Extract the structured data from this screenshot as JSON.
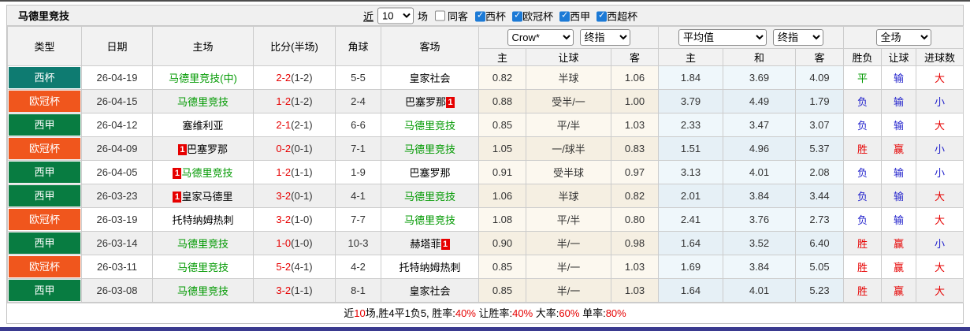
{
  "title": "马德里竞技",
  "controls": {
    "recent_label": "近",
    "recent_value": "10",
    "games_suffix": "场",
    "same_away_label": "同客",
    "league_filters": [
      {
        "label": "西杯",
        "checked": true
      },
      {
        "label": "欧冠杯",
        "checked": true
      },
      {
        "label": "西甲",
        "checked": true
      },
      {
        "label": "西超杯",
        "checked": true
      }
    ]
  },
  "selectors": {
    "company": "Crow*",
    "company_stage": "终指",
    "average": "平均值",
    "average_stage": "终指",
    "scope": "全场"
  },
  "table": {
    "headers": {
      "type": "类型",
      "date": "日期",
      "home": "主场",
      "score": "比分(半场)",
      "corner": "角球",
      "away": "客场",
      "sub": [
        "主",
        "让球",
        "客",
        "主",
        "和",
        "客",
        "胜负",
        "让球",
        "进球数"
      ]
    },
    "league_colors": {
      "西杯": "#0e7b71",
      "欧冠杯": "#f0561d",
      "西甲": "#087c41"
    },
    "rows": [
      {
        "league": "西杯",
        "date": "26-04-19",
        "home": "马德里竞技(中)",
        "home_green": true,
        "home_card": "",
        "score_ft": "2-2",
        "score_ht": "(1-2)",
        "corners": "5-5",
        "away": "皇家社会",
        "away_green": false,
        "away_card": "",
        "odds": [
          "0.82",
          "半球",
          "1.06"
        ],
        "avg": [
          "1.84",
          "3.69",
          "4.09"
        ],
        "results": [
          {
            "text": "平",
            "color": "#009900"
          },
          {
            "text": "输",
            "color": "#2222cc"
          },
          {
            "text": "大",
            "color": "#e60000"
          }
        ]
      },
      {
        "league": "欧冠杯",
        "date": "26-04-15",
        "home": "马德里竞技",
        "home_green": true,
        "home_card": "",
        "score_ft": "1-2",
        "score_ht": "(1-2)",
        "corners": "2-4",
        "away": "巴塞罗那",
        "away_green": false,
        "away_card": "1",
        "odds": [
          "0.88",
          "受半/一",
          "1.00"
        ],
        "avg": [
          "3.79",
          "4.49",
          "1.79"
        ],
        "results": [
          {
            "text": "负",
            "color": "#2222cc"
          },
          {
            "text": "输",
            "color": "#2222cc"
          },
          {
            "text": "小",
            "color": "#2222cc"
          }
        ]
      },
      {
        "league": "西甲",
        "date": "26-04-12",
        "home": "塞维利亚",
        "home_green": false,
        "home_card": "",
        "score_ft": "2-1",
        "score_ht": "(2-1)",
        "corners": "6-6",
        "away": "马德里竞技",
        "away_green": true,
        "away_card": "",
        "odds": [
          "0.85",
          "平/半",
          "1.03"
        ],
        "avg": [
          "2.33",
          "3.47",
          "3.07"
        ],
        "results": [
          {
            "text": "负",
            "color": "#2222cc"
          },
          {
            "text": "输",
            "color": "#2222cc"
          },
          {
            "text": "大",
            "color": "#e60000"
          }
        ]
      },
      {
        "league": "欧冠杯",
        "date": "26-04-09",
        "home": "巴塞罗那",
        "home_green": false,
        "home_card": "1",
        "score_ft": "0-2",
        "score_ht": "(0-1)",
        "corners": "7-1",
        "away": "马德里竞技",
        "away_green": true,
        "away_card": "",
        "odds": [
          "1.05",
          "一/球半",
          "0.83"
        ],
        "avg": [
          "1.51",
          "4.96",
          "5.37"
        ],
        "results": [
          {
            "text": "胜",
            "color": "#e60000"
          },
          {
            "text": "赢",
            "color": "#e60000"
          },
          {
            "text": "小",
            "color": "#2222cc"
          }
        ]
      },
      {
        "league": "西甲",
        "date": "26-04-05",
        "home": "马德里竞技",
        "home_green": true,
        "home_card": "1",
        "score_ft": "1-2",
        "score_ht": "(1-1)",
        "corners": "1-9",
        "away": "巴塞罗那",
        "away_green": false,
        "away_card": "",
        "odds": [
          "0.91",
          "受半球",
          "0.97"
        ],
        "avg": [
          "3.13",
          "4.01",
          "2.08"
        ],
        "results": [
          {
            "text": "负",
            "color": "#2222cc"
          },
          {
            "text": "输",
            "color": "#2222cc"
          },
          {
            "text": "小",
            "color": "#2222cc"
          }
        ]
      },
      {
        "league": "西甲",
        "date": "26-03-23",
        "home": "皇家马德里",
        "home_green": false,
        "home_card": "1",
        "score_ft": "3-2",
        "score_ht": "(0-1)",
        "corners": "4-1",
        "away": "马德里竞技",
        "away_green": true,
        "away_card": "",
        "odds": [
          "1.06",
          "半球",
          "0.82"
        ],
        "avg": [
          "2.01",
          "3.84",
          "3.44"
        ],
        "results": [
          {
            "text": "负",
            "color": "#2222cc"
          },
          {
            "text": "输",
            "color": "#2222cc"
          },
          {
            "text": "大",
            "color": "#e60000"
          }
        ]
      },
      {
        "league": "欧冠杯",
        "date": "26-03-19",
        "home": "托特纳姆热刺",
        "home_green": false,
        "home_card": "",
        "score_ft": "3-2",
        "score_ht": "(1-0)",
        "corners": "7-7",
        "away": "马德里竞技",
        "away_green": true,
        "away_card": "",
        "odds": [
          "1.08",
          "平/半",
          "0.80"
        ],
        "avg": [
          "2.41",
          "3.76",
          "2.73"
        ],
        "results": [
          {
            "text": "负",
            "color": "#2222cc"
          },
          {
            "text": "输",
            "color": "#2222cc"
          },
          {
            "text": "大",
            "color": "#e60000"
          }
        ]
      },
      {
        "league": "西甲",
        "date": "26-03-14",
        "home": "马德里竞技",
        "home_green": true,
        "home_card": "",
        "score_ft": "1-0",
        "score_ht": "(1-0)",
        "corners": "10-3",
        "away": "赫塔菲",
        "away_green": false,
        "away_card": "1",
        "odds": [
          "0.90",
          "半/一",
          "0.98"
        ],
        "avg": [
          "1.64",
          "3.52",
          "6.40"
        ],
        "results": [
          {
            "text": "胜",
            "color": "#e60000"
          },
          {
            "text": "赢",
            "color": "#e60000"
          },
          {
            "text": "小",
            "color": "#2222cc"
          }
        ]
      },
      {
        "league": "欧冠杯",
        "date": "26-03-11",
        "home": "马德里竞技",
        "home_green": true,
        "home_card": "",
        "score_ft": "5-2",
        "score_ht": "(4-1)",
        "corners": "4-2",
        "away": "托特纳姆热刺",
        "away_green": false,
        "away_card": "",
        "odds": [
          "0.85",
          "半/一",
          "1.03"
        ],
        "avg": [
          "1.69",
          "3.84",
          "5.05"
        ],
        "results": [
          {
            "text": "胜",
            "color": "#e60000"
          },
          {
            "text": "赢",
            "color": "#e60000"
          },
          {
            "text": "大",
            "color": "#e60000"
          }
        ]
      },
      {
        "league": "西甲",
        "date": "26-03-08",
        "home": "马德里竞技",
        "home_green": true,
        "home_card": "",
        "score_ft": "3-2",
        "score_ht": "(1-1)",
        "corners": "8-1",
        "away": "皇家社会",
        "away_green": false,
        "away_card": "",
        "odds": [
          "0.85",
          "半/一",
          "1.03"
        ],
        "avg": [
          "1.64",
          "4.01",
          "5.23"
        ],
        "results": [
          {
            "text": "胜",
            "color": "#e60000"
          },
          {
            "text": "赢",
            "color": "#e60000"
          },
          {
            "text": "大",
            "color": "#e60000"
          }
        ]
      }
    ]
  },
  "footer_segments": [
    {
      "text": "近",
      "red": false
    },
    {
      "text": "10",
      "red": true
    },
    {
      "text": "场,胜4平1负5, 胜率:",
      "red": false
    },
    {
      "text": "40%",
      "red": true
    },
    {
      "text": " 让胜率:",
      "red": false
    },
    {
      "text": "40%",
      "red": true
    },
    {
      "text": " 大率:",
      "red": false
    },
    {
      "text": "60%",
      "red": true
    },
    {
      "text": " 单率:",
      "red": false
    },
    {
      "text": "80%",
      "red": true
    }
  ]
}
